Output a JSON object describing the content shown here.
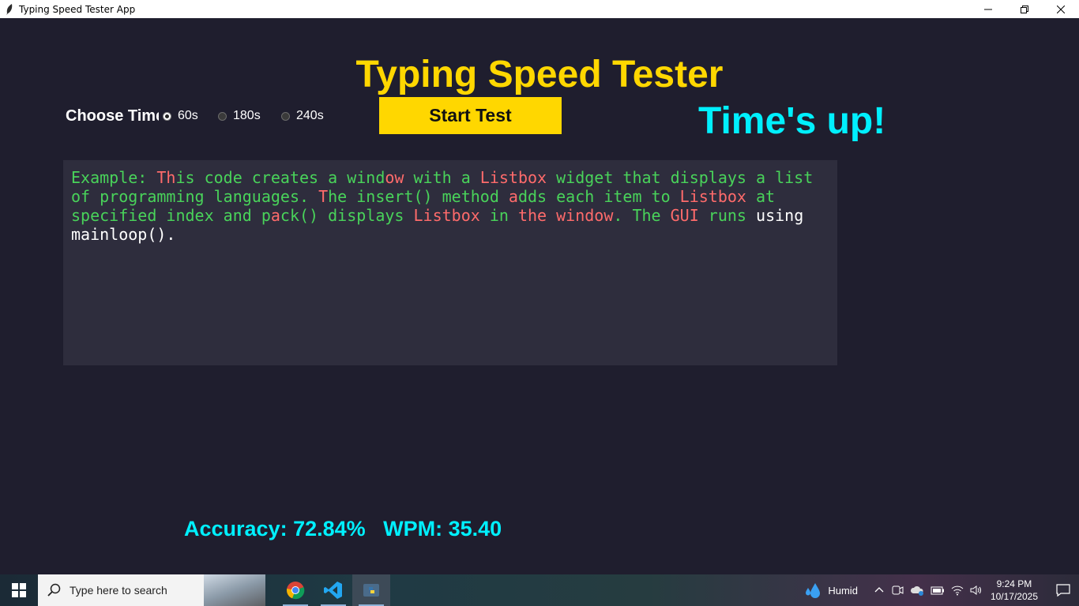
{
  "window": {
    "title": "Typing Speed Tester App"
  },
  "app": {
    "heading": "Typing Speed Tester",
    "choose_time_label": "Choose Time",
    "time_options": [
      {
        "label": "60s",
        "selected": true
      },
      {
        "label": "180s",
        "selected": false
      },
      {
        "label": "240s",
        "selected": false
      }
    ],
    "start_button": "Start Test",
    "status": "Time's up!",
    "text_segments": [
      {
        "text": "Example: ",
        "state": "ok"
      },
      {
        "text": "Th",
        "state": "err"
      },
      {
        "text": "is code creates a wind",
        "state": "ok"
      },
      {
        "text": "ow",
        "state": "err"
      },
      {
        "text": " with a ",
        "state": "ok"
      },
      {
        "text": "Listbox",
        "state": "err"
      },
      {
        "text": " widget that displays a list of programming languages. ",
        "state": "ok"
      },
      {
        "text": "T",
        "state": "err"
      },
      {
        "text": "he insert() method ",
        "state": "ok"
      },
      {
        "text": "a",
        "state": "err"
      },
      {
        "text": "dds each item to ",
        "state": "ok"
      },
      {
        "text": "Listbox",
        "state": "err"
      },
      {
        "text": " at specified index and p",
        "state": "ok"
      },
      {
        "text": "a",
        "state": "err"
      },
      {
        "text": "ck() displays ",
        "state": "ok"
      },
      {
        "text": "Listbox",
        "state": "err"
      },
      {
        "text": " in ",
        "state": "ok"
      },
      {
        "text": "the",
        "state": "err"
      },
      {
        "text": " ",
        "state": "ok"
      },
      {
        "text": "window",
        "state": "err"
      },
      {
        "text": ". The ",
        "state": "ok"
      },
      {
        "text": "GUI",
        "state": "err"
      },
      {
        "text": " runs",
        "state": "ok"
      },
      {
        "text": " using mainloop().",
        "state": "rest"
      }
    ],
    "result": "Accuracy: 72.84%   WPM: 35.40",
    "colors": {
      "accent_yellow": "#ffd700",
      "accent_cyan": "#00f0ff",
      "correct": "#49d35a",
      "incorrect": "#ff6b6b",
      "background": "#1f1e2e"
    }
  },
  "taskbar": {
    "search_placeholder": "Type here to search",
    "apps": [
      "chrome-icon",
      "vscode-icon",
      "python-icon"
    ],
    "weather": "Humid",
    "time": "9:24 PM",
    "date": "10/17/2025"
  }
}
